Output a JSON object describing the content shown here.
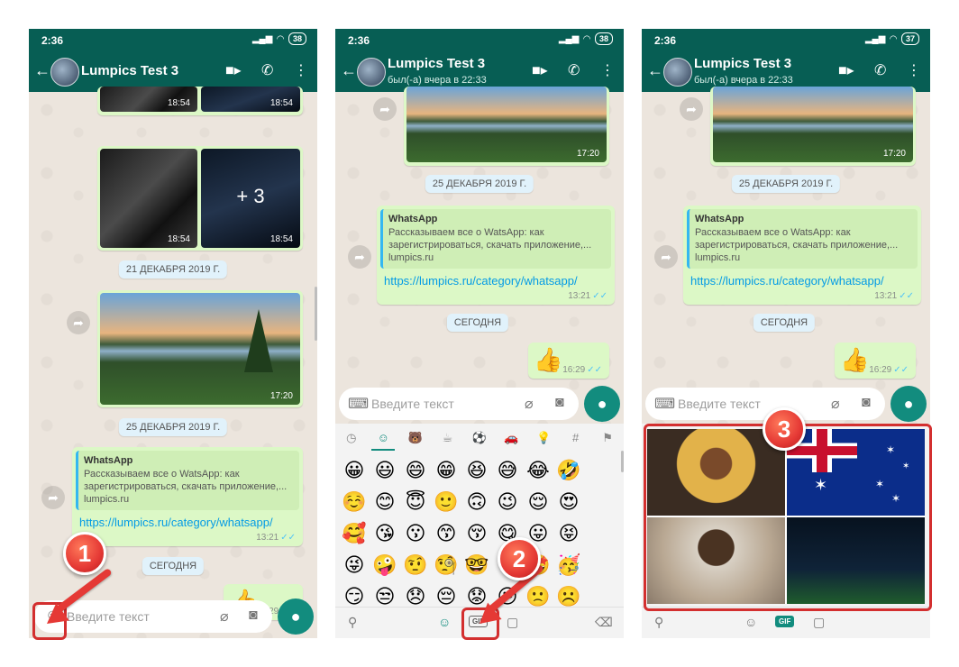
{
  "statusbar": {
    "time": "2:36",
    "battery_1": "38",
    "battery_2": "38",
    "battery_3": "37"
  },
  "contact": {
    "name": "Lumpics Test 3",
    "last_seen": "был(-а) вчера в 22:33"
  },
  "messages": {
    "time_grid": "18:54",
    "more_photos": "+ 3",
    "date_21": "21 ДЕКАБРЯ 2019 Г.",
    "time_photo": "17:20",
    "date_25": "25 ДЕКАБРЯ 2019 Г.",
    "link_title": "WhatsApp",
    "link_desc": "Рассказываем все о WatsApp: как зарегистрироваться, скачать приложение,...",
    "link_domain": "lumpics.ru",
    "link_url": "https://lumpics.ru/category/whatsapp/",
    "time_link": "13:21",
    "date_today": "СЕГОДНЯ",
    "time_thumb": "16:29"
  },
  "input": {
    "placeholder": "Введите текст"
  },
  "keyboard": {
    "gif_label": "GIF"
  },
  "steps": [
    "1",
    "2",
    "3"
  ],
  "colors": {
    "header": "#075e54",
    "accent": "#128c7e",
    "bubble_out": "#dcf8c6",
    "annotation": "#e53935"
  },
  "icons": [
    "back-arrow-icon",
    "video-call-icon",
    "phone-icon",
    "more-vert-icon",
    "emoji-icon",
    "attach-icon",
    "camera-icon",
    "mic-icon",
    "forward-icon",
    "keyboard-icon",
    "search-icon",
    "sticker-icon",
    "backspace-icon"
  ]
}
